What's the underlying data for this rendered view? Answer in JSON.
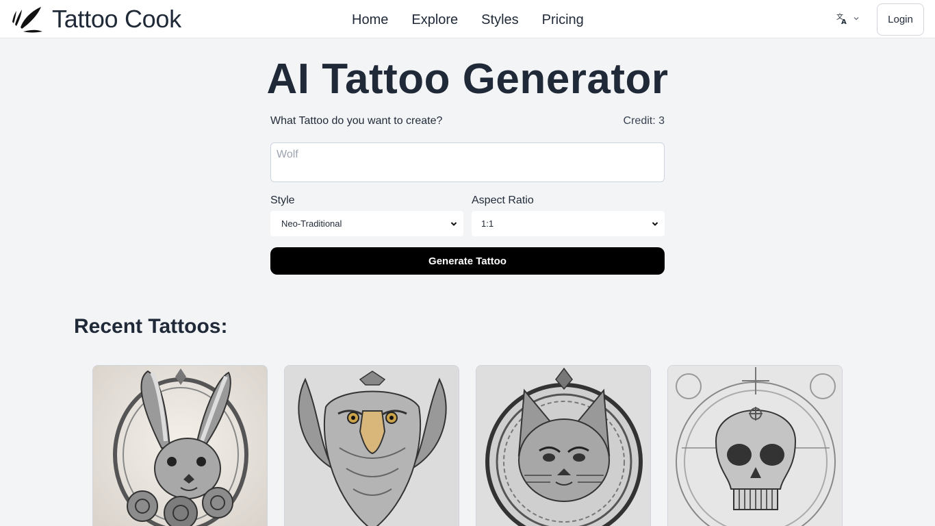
{
  "header": {
    "brand": "Tattoo Cook",
    "nav": [
      {
        "label": "Home"
      },
      {
        "label": "Explore"
      },
      {
        "label": "Styles"
      },
      {
        "label": "Pricing"
      }
    ],
    "language_icon": "translate-icon",
    "login_label": "Login"
  },
  "main": {
    "title": "AI Tattoo Generator",
    "prompt_label": "What Tattoo do you want to create?",
    "credit": "Credit: 3",
    "prompt_placeholder": "Wolf",
    "style_label": "Style",
    "style_value": "Neo-Traditional",
    "aspect_label": "Aspect Ratio",
    "aspect_value": "1:1",
    "generate_label": "Generate Tattoo"
  },
  "recent": {
    "title": "Recent Tattoos:",
    "items": [
      {
        "subject": "rabbit"
      },
      {
        "subject": "eagle"
      },
      {
        "subject": "cat"
      },
      {
        "subject": "skull"
      }
    ]
  },
  "colors": {
    "background": "#f3f4f6",
    "text": "#1f2937",
    "button": "#000000"
  }
}
